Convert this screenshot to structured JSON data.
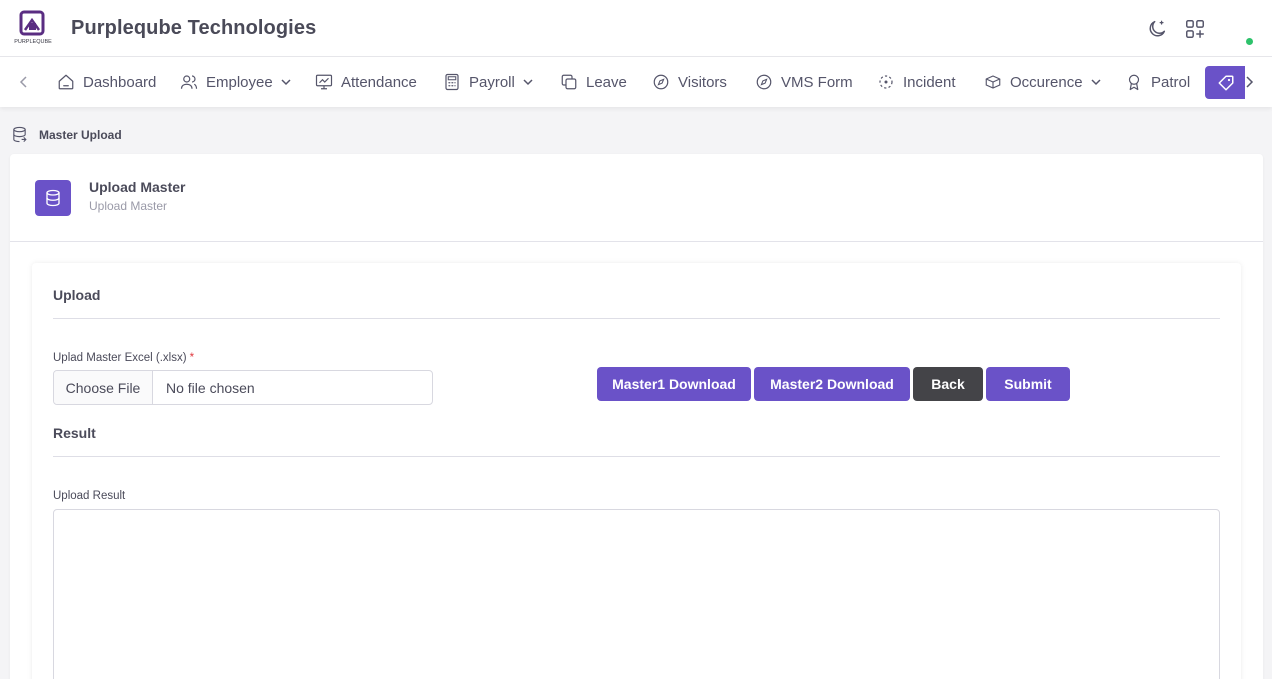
{
  "header": {
    "company_name": "Purpleqube Technologies",
    "logo_text": "PURPLEQUBE",
    "icons": [
      "moon-icon",
      "apps-add-icon"
    ],
    "status_color": "#2dc26b"
  },
  "nav": {
    "items": [
      {
        "label": "Dashboard",
        "icon": "home-icon",
        "dropdown": false
      },
      {
        "label": "Employee",
        "icon": "users-icon",
        "dropdown": true
      },
      {
        "label": "Attendance",
        "icon": "chart-monitor-icon",
        "dropdown": false
      },
      {
        "label": "Payroll",
        "icon": "calculator-icon",
        "dropdown": true
      },
      {
        "label": "Leave",
        "icon": "copy-icon",
        "dropdown": false
      },
      {
        "label": "Visitors",
        "icon": "compass-icon",
        "dropdown": false
      },
      {
        "label": "VMS Form",
        "icon": "compass-icon",
        "dropdown": false
      },
      {
        "label": "Incident",
        "icon": "focus-icon",
        "dropdown": false
      },
      {
        "label": "Occurence",
        "icon": "boxes-icon",
        "dropdown": true
      },
      {
        "label": "Patrol",
        "icon": "award-icon",
        "dropdown": false
      }
    ],
    "active_icon": "tag-icon",
    "accent_color": "#6a52c8"
  },
  "breadcrumb": {
    "label": "Master Upload"
  },
  "card": {
    "title": "Upload Master",
    "subtitle": "Upload Master"
  },
  "upload": {
    "section_title": "Upload",
    "field_label": "Uplad Master Excel (.xlsx)",
    "required_mark": "*",
    "file_button": "Choose File",
    "file_status": "No file chosen",
    "buttons": {
      "master1": "Master1 Download",
      "master2": "Master2 Download",
      "back": "Back",
      "submit": "Submit"
    }
  },
  "result": {
    "section_title": "Result",
    "field_label": "Upload Result",
    "value": ""
  }
}
